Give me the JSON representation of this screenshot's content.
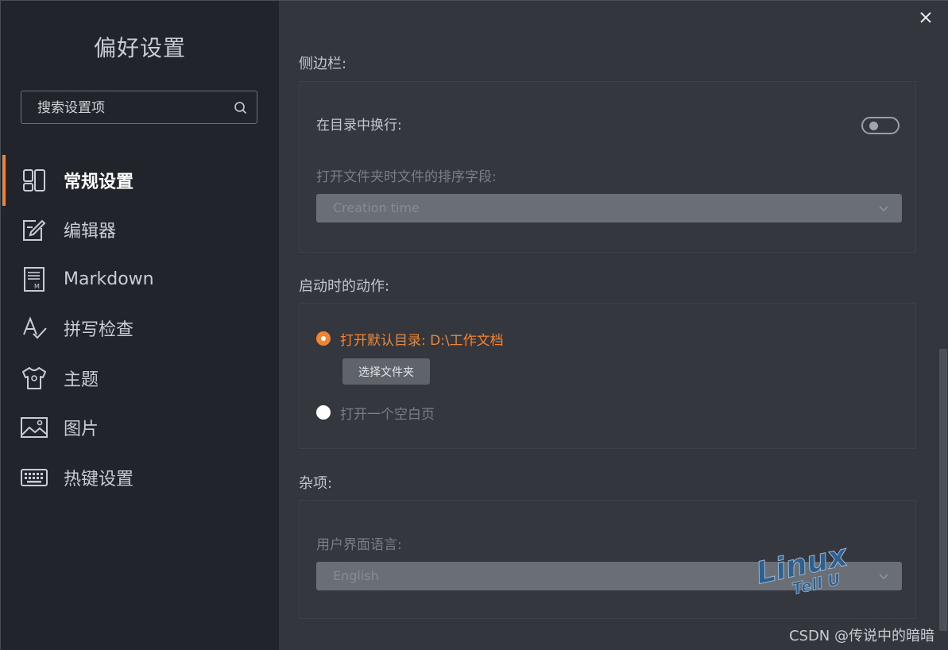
{
  "sidebar": {
    "title": "偏好设置",
    "search_placeholder": "搜索设置项",
    "items": [
      {
        "label": "常规设置",
        "icon": "layout-icon",
        "active": true
      },
      {
        "label": "编辑器",
        "icon": "edit-icon"
      },
      {
        "label": "Markdown",
        "icon": "markdown-file-icon"
      },
      {
        "label": "拼写检查",
        "icon": "spellcheck-icon"
      },
      {
        "label": "主题",
        "icon": "shirt-icon"
      },
      {
        "label": "图片",
        "icon": "image-icon"
      },
      {
        "label": "热键设置",
        "icon": "keyboard-icon"
      }
    ]
  },
  "main": {
    "sections": {
      "sidebar": {
        "title": "侧边栏:",
        "wrap_toc_label": "在目录中换行:",
        "wrap_toc_enabled": false,
        "sort_label": "打开文件夹时文件的排序字段:",
        "sort_value": "Creation time"
      },
      "startup": {
        "title": "启动时的动作:",
        "option_default_dir": "打开默认目录: D:\\工作文档",
        "choose_folder_button": "选择文件夹",
        "option_blank": "打开一个空白页",
        "selected": "default_dir"
      },
      "misc": {
        "title": "杂项:",
        "language_label": "用户界面语言:",
        "language_value": "English"
      }
    }
  },
  "overlay": {
    "watermark_text_top": "Linux",
    "watermark_text_bottom": "Tell U",
    "credit": "CSDN @传说中的暗暗"
  },
  "colors": {
    "accent": "#ef8533",
    "sidebar_bg": "#21252b",
    "main_bg": "#33373d"
  }
}
